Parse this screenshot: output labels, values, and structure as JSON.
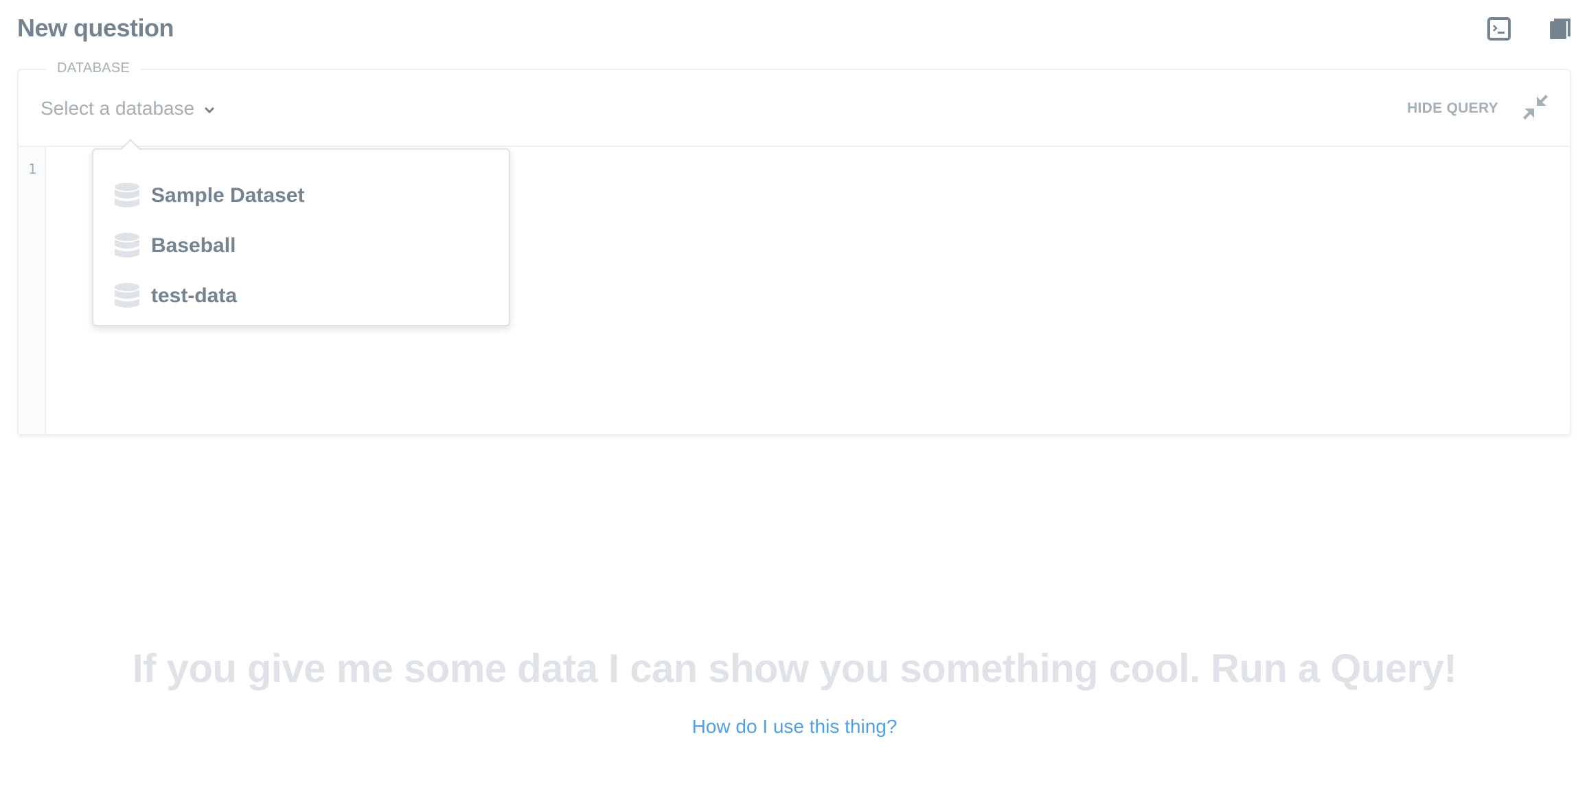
{
  "header": {
    "title": "New question",
    "actions": [
      {
        "icon": "sql-editor-icon"
      },
      {
        "icon": "reference-panel-icon"
      }
    ]
  },
  "editor": {
    "database_legend": "DATABASE",
    "database_select": {
      "placeholder": "Select a database",
      "icon": "chevron-down-icon"
    },
    "hide_query_label": "HIDE QUERY",
    "collapse_icon": "collapse-icon",
    "line_numbers": [
      "1"
    ],
    "query_text": ""
  },
  "database_dropdown": {
    "open": true,
    "items": [
      {
        "label": "Sample Dataset",
        "icon": "database-icon"
      },
      {
        "label": "Baseball",
        "icon": "database-icon"
      },
      {
        "label": "test-data",
        "icon": "database-icon"
      }
    ]
  },
  "empty_state": {
    "message": "If you give me some data I can show you something cool. Run a Query!",
    "help_link": "How do I use this thing?"
  },
  "colors": {
    "text_primary": "#74838f",
    "text_muted": "#a5afb6",
    "border": "#eef0f3",
    "icon_fill": "#dfe3e7",
    "link": "#509ee3"
  }
}
